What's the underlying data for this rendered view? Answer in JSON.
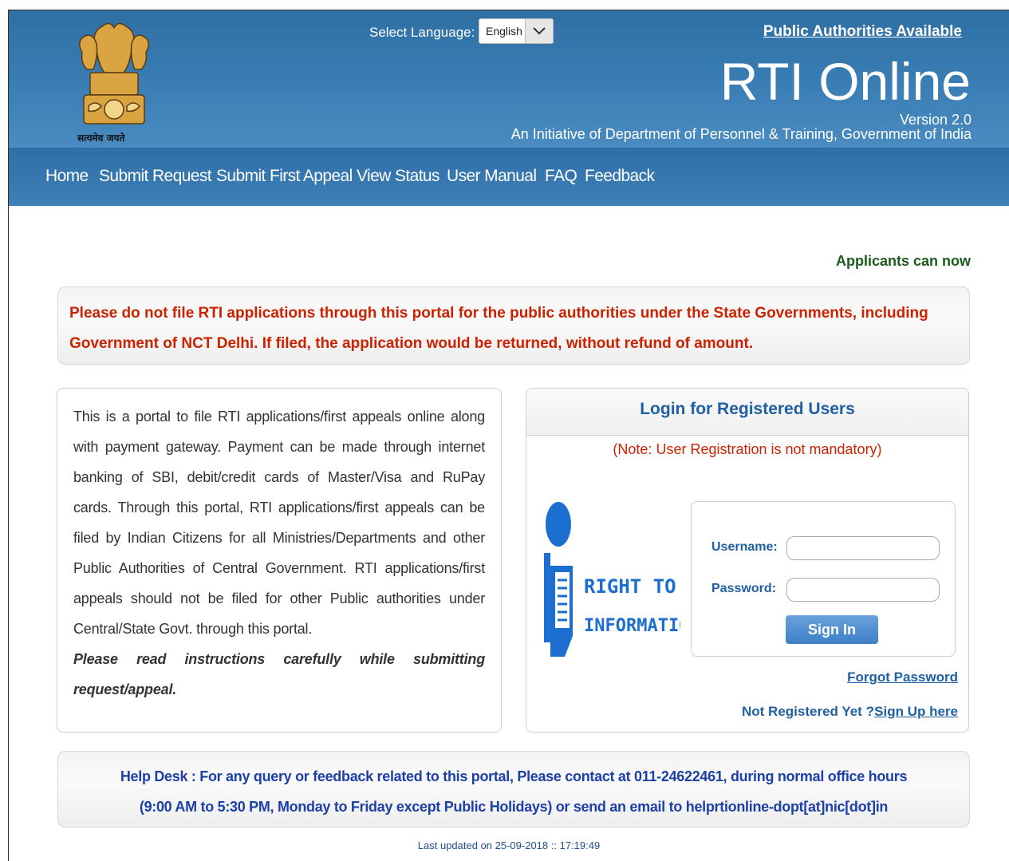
{
  "header": {
    "emblem_caption": "सत्यमेव जयते",
    "select_language_label": "Select Language:",
    "language_selected": "English",
    "public_authorities_link": "Public Authorities Available",
    "brand_title": "RTI Online",
    "version": "Version 2.0",
    "initiative": "An Initiative of Department of Personnel & Training, Government of India"
  },
  "nav": {
    "items": [
      "Home",
      "Submit Request",
      "Submit First Appeal",
      "View Status",
      "User Manual",
      "FAQ",
      "Feedback"
    ]
  },
  "marquee_text": "Applicants can now",
  "notice": {
    "text": "Please do not file RTI applications through this portal for the public authorities under the State Governments, including Government of NCT Delhi. If filed, the application would be returned, without refund of amount."
  },
  "about": {
    "text": "This is a portal to file RTI applications/first appeals online along with payment gateway. Payment can be made through internet banking of SBI, debit/credit cards of Master/Visa and RuPay cards. Through this portal, RTI applications/first appeals can be filed by Indian Citizens for all Ministries/Departments and other Public Authorities of Central Government. RTI applications/first appeals should not be filed for other Public authorities under Central/State Govt. through this portal.",
    "instruction": "Please read instructions carefully while submitting request/appeal."
  },
  "login": {
    "title": "Login for Registered Users",
    "note": "(Note: User Registration is not mandatory)",
    "logo_line1": "RIGHT TO",
    "logo_line2": "INFORMATION",
    "username_label": "Username:",
    "password_label": "Password:",
    "username_value": "",
    "password_value": "",
    "sign_in_label": "Sign In",
    "forgot_password": "Forgot Password",
    "not_registered": "Not Registered Yet ?",
    "sign_up": "Sign Up here"
  },
  "helpdesk": {
    "line1": "Help Desk : For any query or feedback related to this portal, Please contact at 011-24622461, during normal office hours",
    "line2": "(9:00 AM to 5:30 PM, Monday to Friday except Public Holidays) or send an email to helprtionline-dopt[at]nic[dot]in"
  },
  "footer": {
    "last_updated": "Last updated on 25-09-2018 :: 17:19:49"
  },
  "colors": {
    "header_blue": "#3a7eb5",
    "notice_red": "#cc2200",
    "link_blue": "#1f5fa3",
    "marquee_green": "#1b5a1b"
  }
}
